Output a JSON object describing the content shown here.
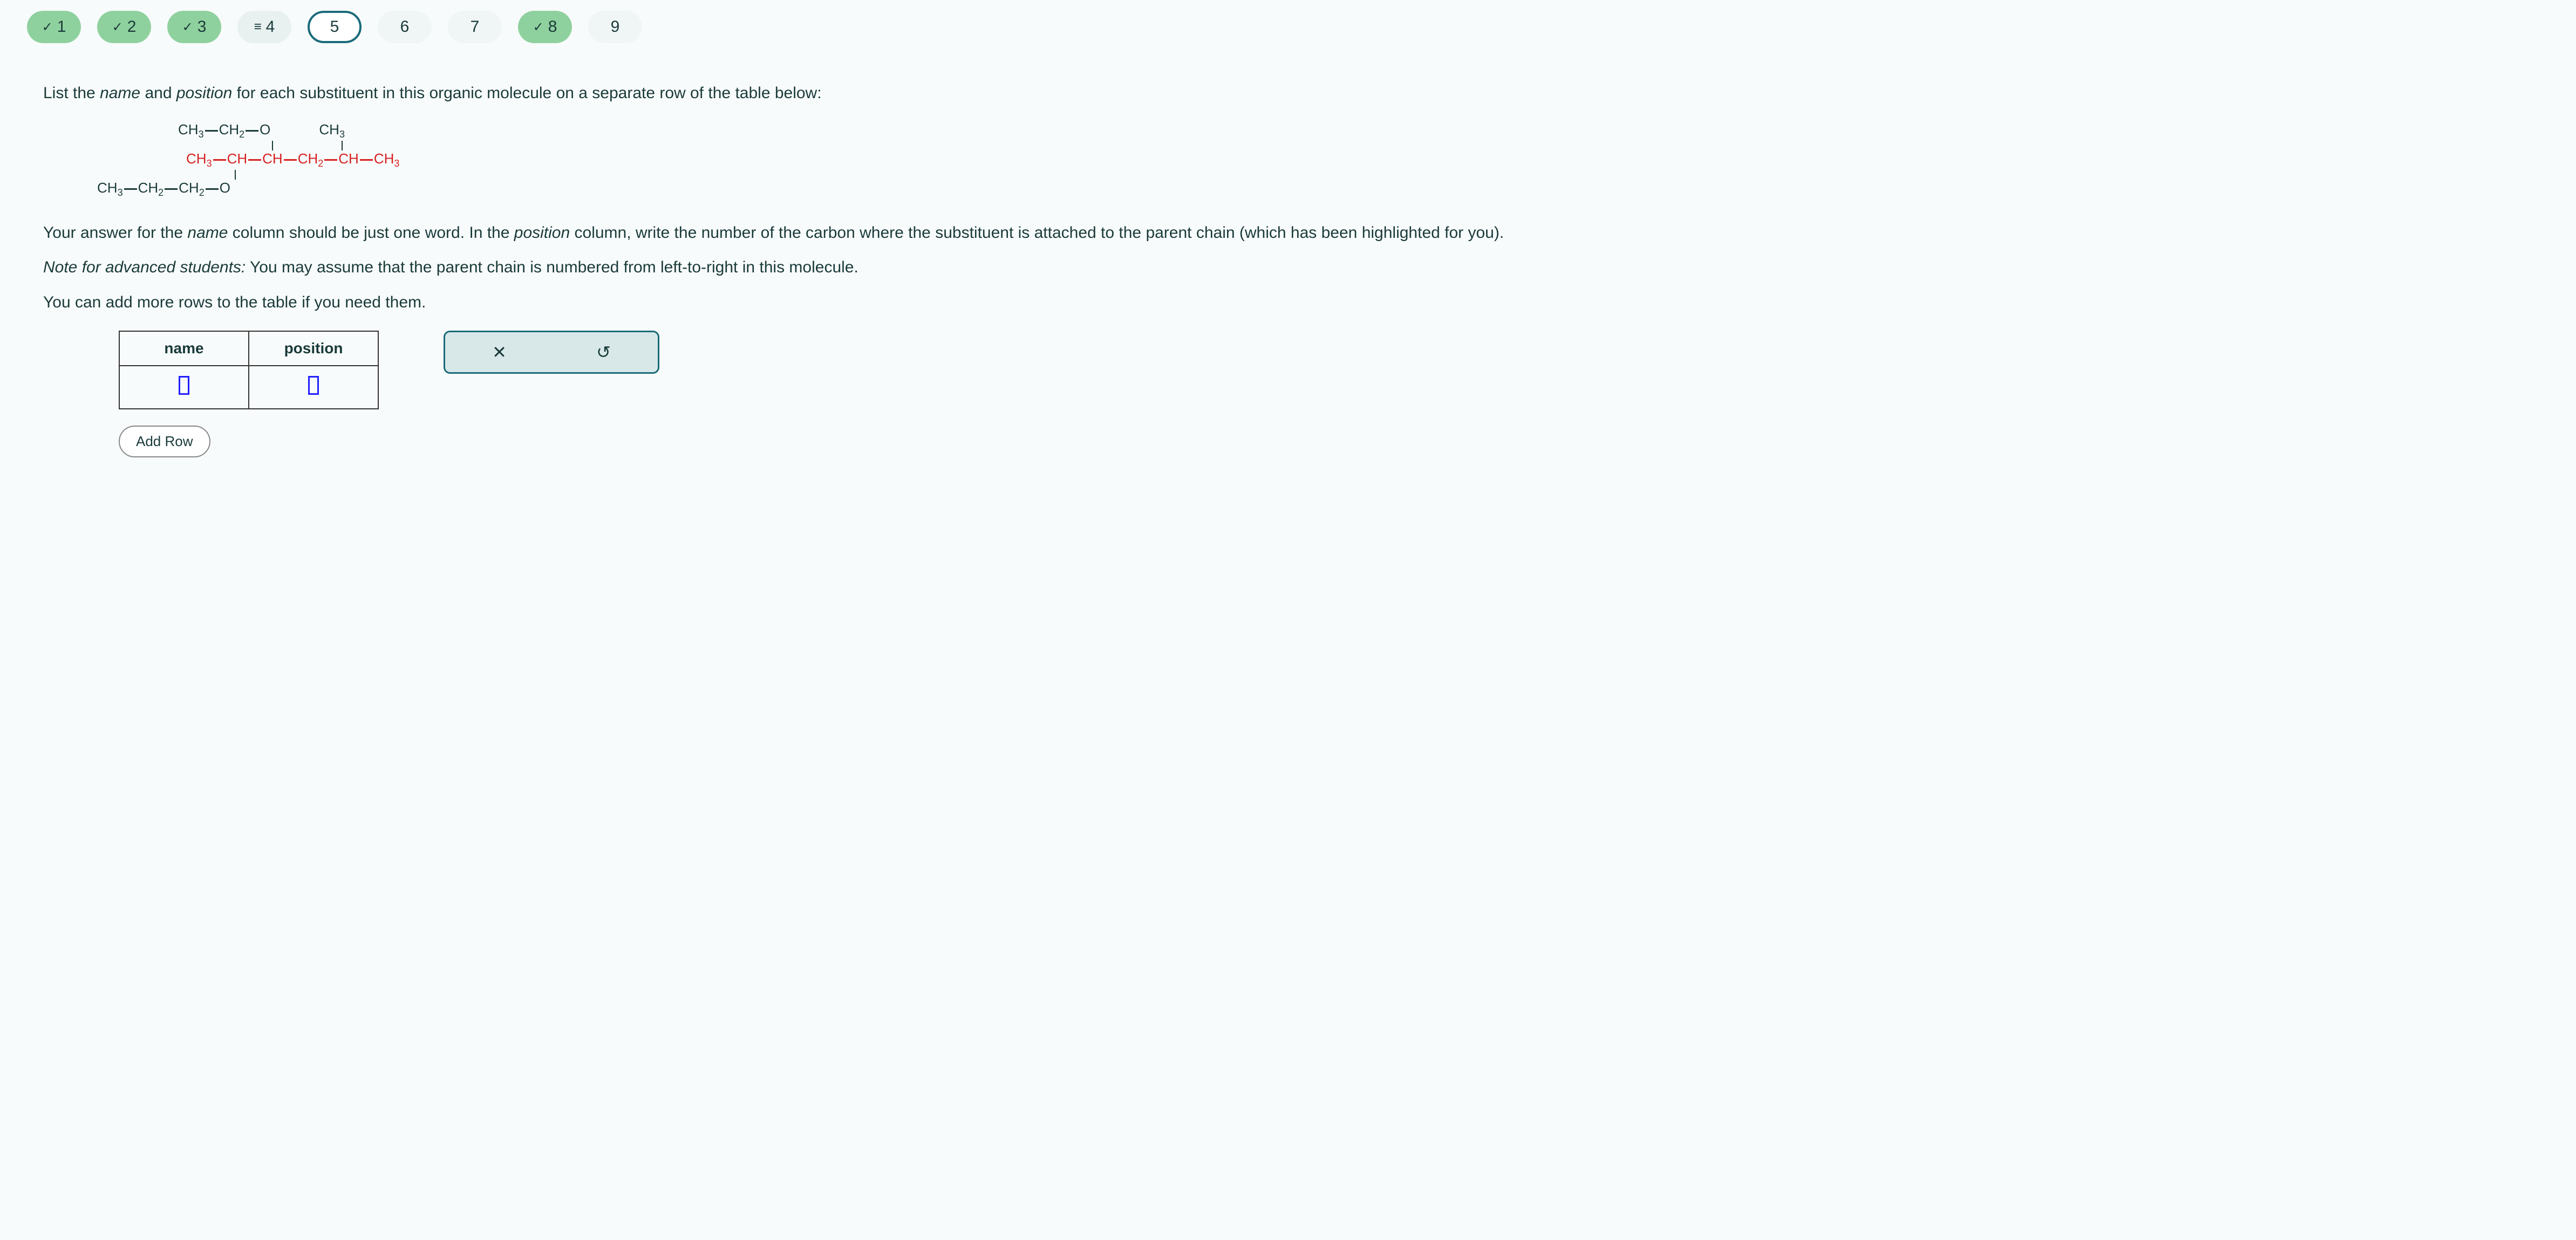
{
  "nav": {
    "items": [
      {
        "label": "1",
        "state": "completed"
      },
      {
        "label": "2",
        "state": "completed"
      },
      {
        "label": "3",
        "state": "completed"
      },
      {
        "label": "4",
        "state": "current-eq"
      },
      {
        "label": "5",
        "state": "active"
      },
      {
        "label": "6",
        "state": "plain"
      },
      {
        "label": "7",
        "state": "plain"
      },
      {
        "label": "8",
        "state": "completed"
      },
      {
        "label": "9",
        "state": "plain"
      }
    ]
  },
  "question": {
    "prompt_pre": "List the ",
    "prompt_em1": "name",
    "prompt_mid1": " and ",
    "prompt_em2": "position",
    "prompt_post": " for each substituent in this organic molecule on a separate row of the table below:"
  },
  "instructions": {
    "p1_pre": "Your answer for the ",
    "p1_em1": "name",
    "p1_mid": " column should be just one word. In the ",
    "p1_em2": "position",
    "p1_post": " column, write the number of the carbon where the substituent is attached to the parent chain (which has been highlighted for you).",
    "note_pre": "Note for advanced students:",
    "note_post": " You may assume that the parent chain is numbered from left-to-right in this molecule.",
    "p2": "You can add more rows to the table if you need them."
  },
  "table": {
    "headers": {
      "name": "name",
      "position": "position"
    },
    "rows": [
      {
        "name": "",
        "position": ""
      }
    ]
  },
  "buttons": {
    "add_row": "Add Row"
  },
  "molecule": {
    "top_branch_left": "CH3—CH2—O",
    "top_branch_right": "CH3",
    "main_chain": "CH3—CH—CH—CH2—CH—CH3",
    "bottom_branch": "CH3—CH2—CH2—O"
  }
}
